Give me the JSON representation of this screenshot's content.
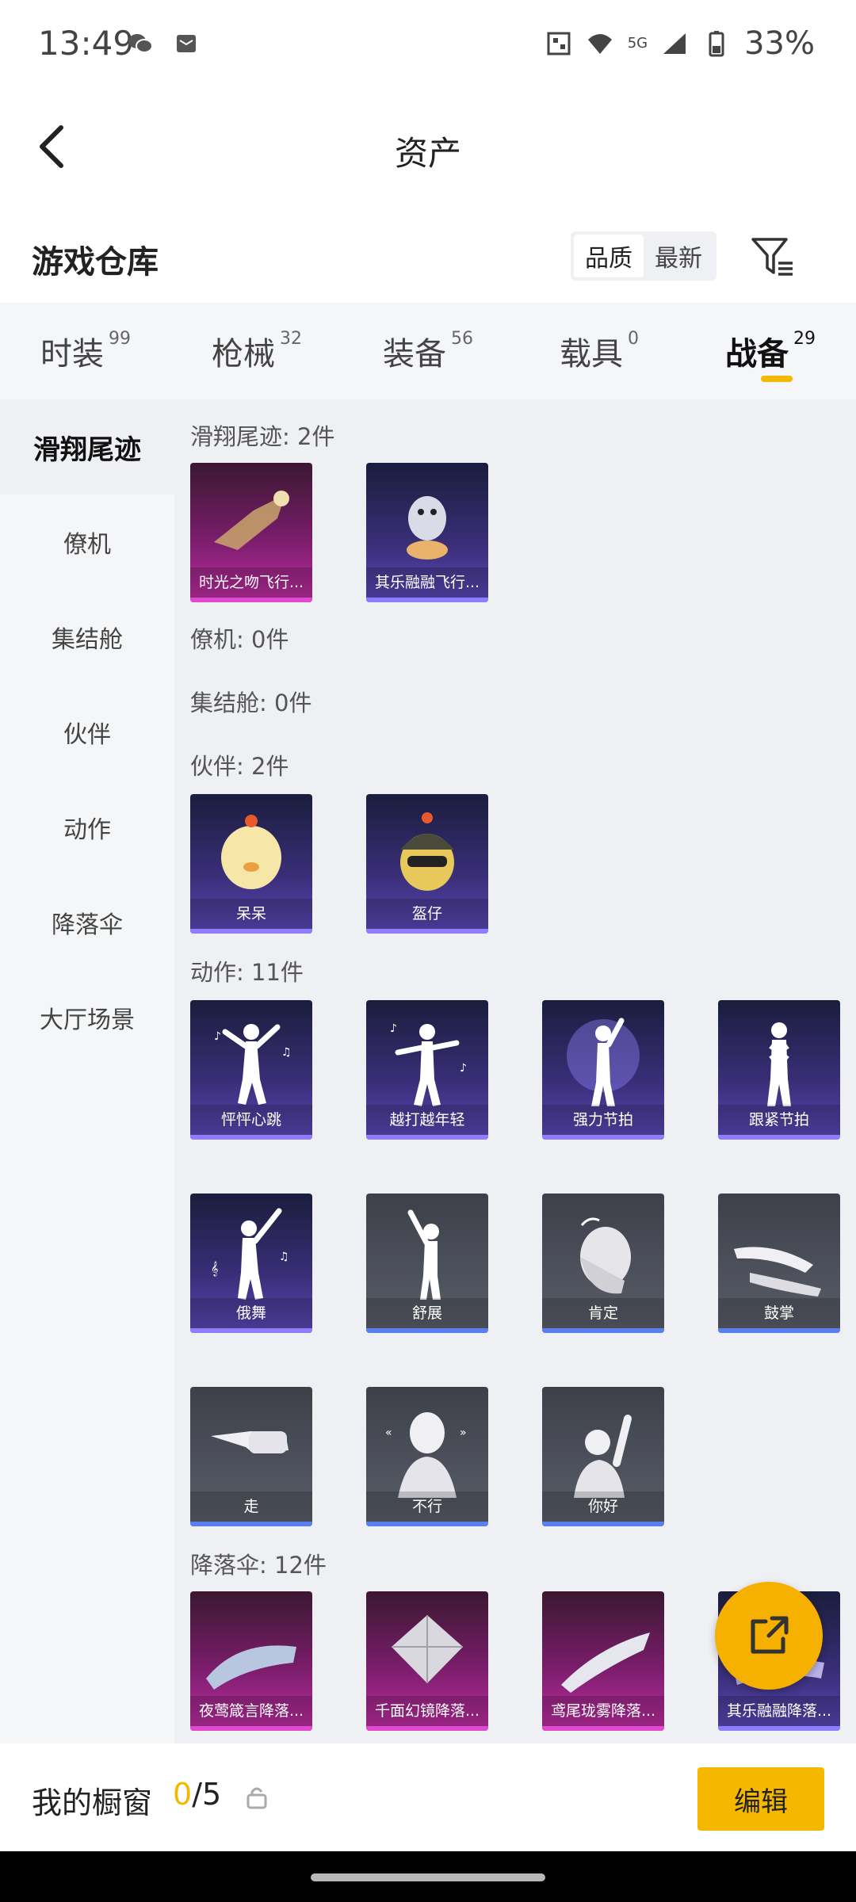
{
  "status_bar": {
    "time": "13:49",
    "network": "5G",
    "battery": "33%"
  },
  "header": {
    "title": "资产"
  },
  "warehouse": {
    "title": "游戏仓库",
    "sort_quality": "品质",
    "sort_newest": "最新"
  },
  "tabs": [
    {
      "label": "时装",
      "count": "99"
    },
    {
      "label": "枪械",
      "count": "32"
    },
    {
      "label": "装备",
      "count": "56"
    },
    {
      "label": "载具",
      "count": "0"
    },
    {
      "label": "战备",
      "count": "29",
      "active": true
    }
  ],
  "side_nav": [
    "滑翔尾迹",
    "僚机",
    "集结舱",
    "伙伴",
    "动作",
    "降落伞",
    "大厅场景"
  ],
  "sections": {
    "glide": {
      "label": "滑翔尾迹: 2件",
      "items": [
        "时光之吻飞行...",
        "其乐融融飞行..."
      ]
    },
    "wingman": {
      "label": "僚机: 0件"
    },
    "capsule": {
      "label": "集结舱: 0件"
    },
    "partner": {
      "label": "伙伴: 2件",
      "items": [
        "呆呆",
        "盔仔"
      ]
    },
    "emote": {
      "label": "动作: 11件",
      "items": [
        "怦怦心跳",
        "越打越年轻",
        "强力节拍",
        "跟紧节拍",
        "俄舞",
        "舒展",
        "肯定",
        "鼓掌",
        "走",
        "不行",
        "你好"
      ]
    },
    "parachute": {
      "label": "降落伞: 12件",
      "items": [
        "夜莺箴言降落...",
        "千面幻镜降落...",
        "鸢尾珑雾降落...",
        "其乐融融降落..."
      ]
    }
  },
  "bottom": {
    "showcase_label": "我的橱窗",
    "showcase_current": "0",
    "showcase_total": "/5",
    "edit_label": "编辑"
  },
  "colors": {
    "accent": "#f5b800",
    "quality_pink": "#c02ea3",
    "quality_purple": "#5b49b8",
    "quality_grey": "#5a5e69"
  }
}
